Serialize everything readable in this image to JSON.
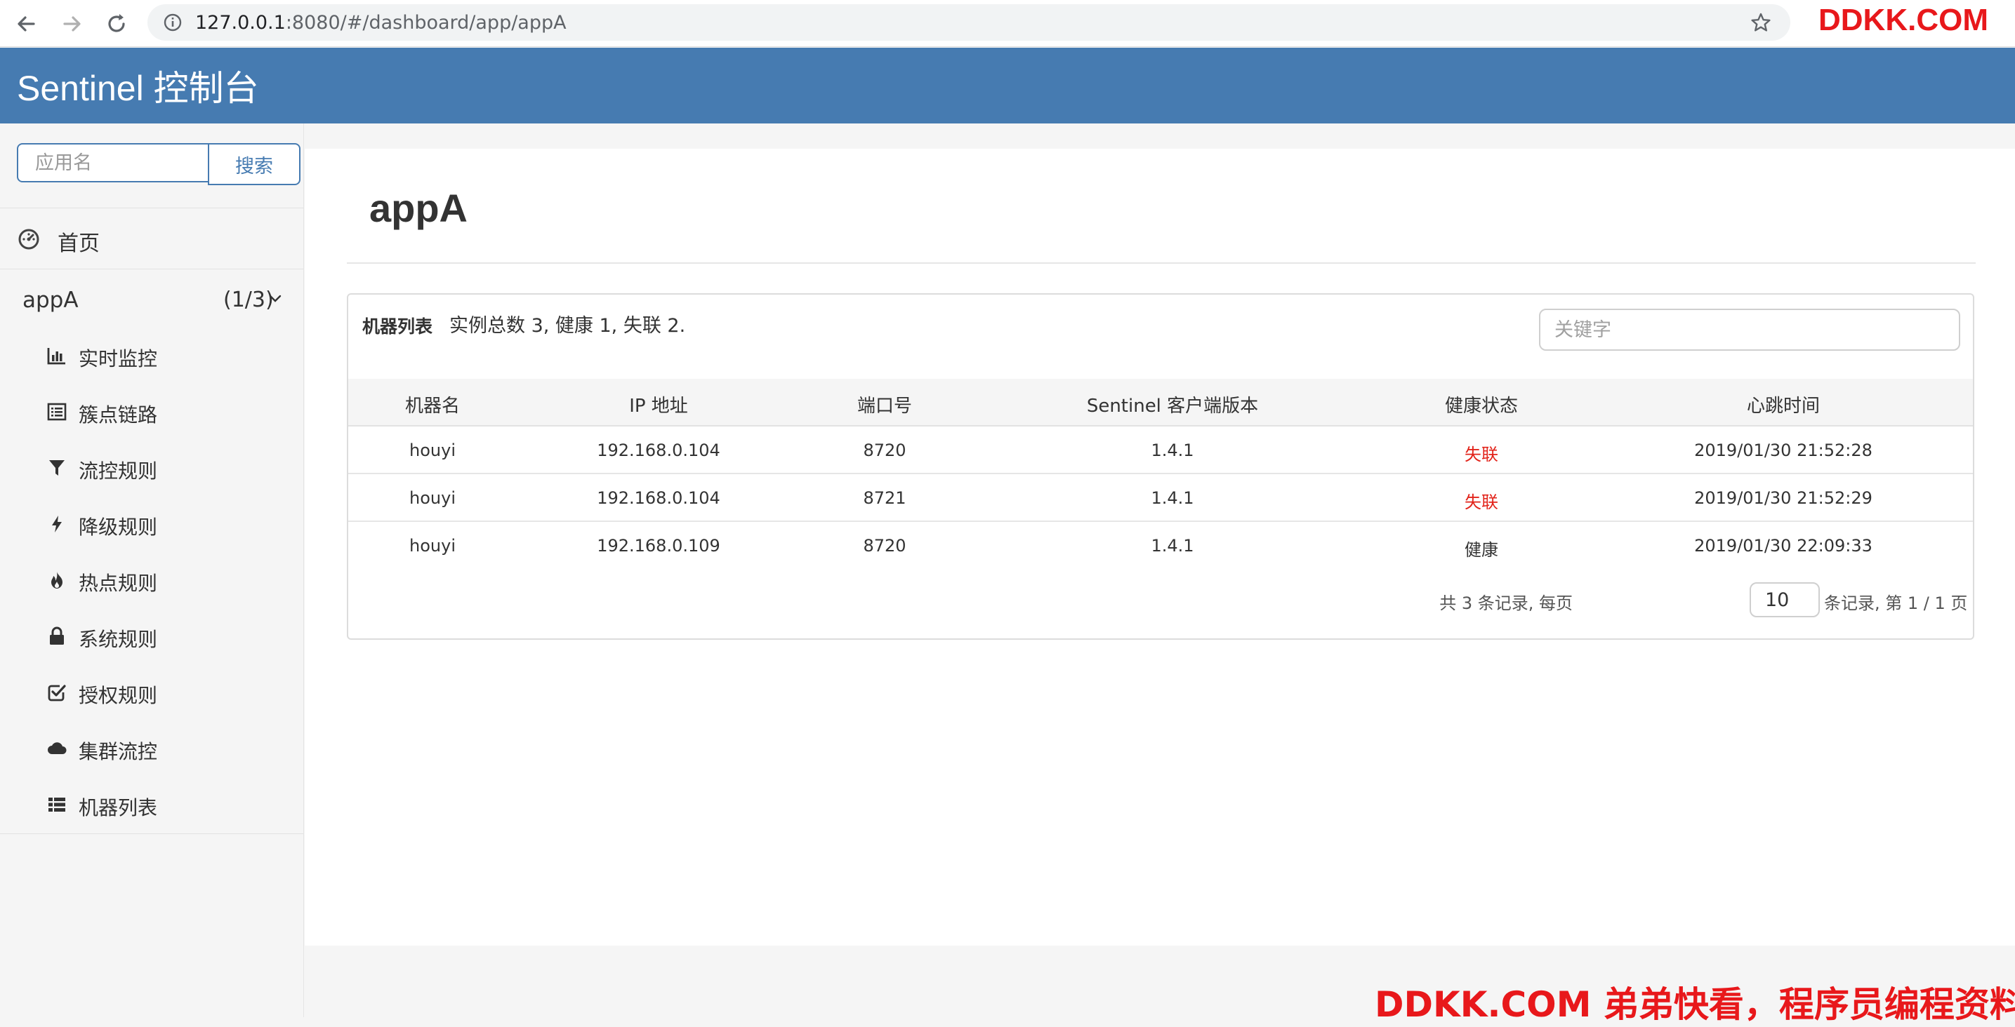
{
  "browser": {
    "url_host": "127.0.0.1",
    "url_rest": ":8080/#/dashboard/app/appA"
  },
  "watermark": {
    "top": "DDKK.COM",
    "bottom": "DDKK.COM 弟弟快看，程序员编程资料站"
  },
  "header": {
    "brand": "Sentinel 控制台"
  },
  "sidebar": {
    "search_placeholder": "应用名",
    "search_button": "搜索",
    "home": "首页",
    "app": {
      "name": "appA",
      "count": "(1/3)"
    },
    "items": [
      {
        "label": "实时监控",
        "icon": "bar-chart-icon"
      },
      {
        "label": "簇点链路",
        "icon": "list-alt-icon"
      },
      {
        "label": "流控规则",
        "icon": "filter-icon"
      },
      {
        "label": "降级规则",
        "icon": "flash-icon"
      },
      {
        "label": "热点规则",
        "icon": "fire-icon"
      },
      {
        "label": "系统规则",
        "icon": "lock-icon"
      },
      {
        "label": "授权规则",
        "icon": "check-icon"
      },
      {
        "label": "集群流控",
        "icon": "cloud-icon"
      },
      {
        "label": "机器列表",
        "icon": "th-list-icon"
      }
    ]
  },
  "main": {
    "title": "appA",
    "panel": {
      "title": "机器列表",
      "summary": "实例总数 3, 健康 1, 失联 2.",
      "keyword_placeholder": "关键字",
      "columns": [
        "机器名",
        "IP 地址",
        "端口号",
        "Sentinel 客户端版本",
        "健康状态",
        "心跳时间"
      ],
      "rows": [
        [
          "houyi",
          "192.168.0.104",
          "8720",
          "1.4.1",
          "失联",
          "2019/01/30 21:52:28"
        ],
        [
          "houyi",
          "192.168.0.104",
          "8721",
          "1.4.1",
          "失联",
          "2019/01/30 21:52:29"
        ],
        [
          "houyi",
          "192.168.0.109",
          "8720",
          "1.4.1",
          "健康",
          "2019/01/30 22:09:33"
        ]
      ],
      "pager": {
        "prefix": "共 3 条记录, 每页",
        "page_size": "10",
        "suffix": "条记录, 第 1 / 1 页"
      }
    }
  },
  "colors": {
    "header_bg": "#467bb1",
    "status_lost": "#e2231a",
    "watermark": "#e8181b"
  }
}
